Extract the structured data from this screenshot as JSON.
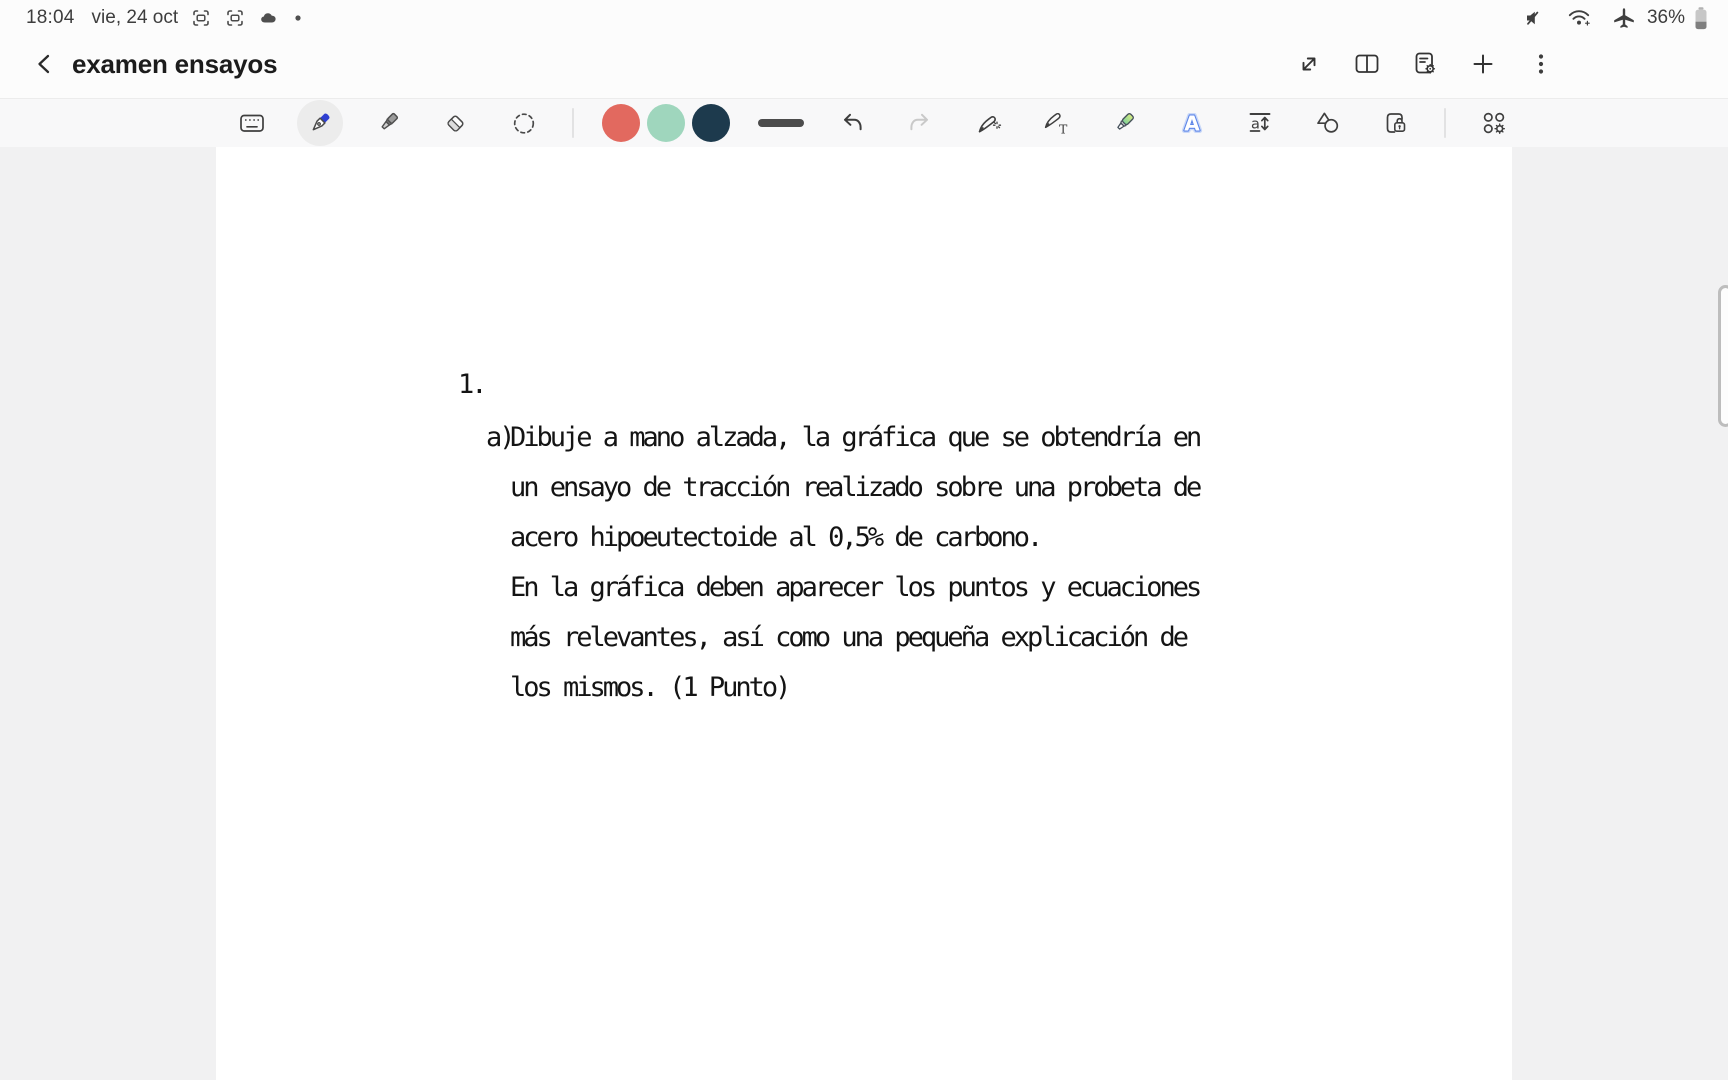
{
  "status_bar": {
    "time": "18:04",
    "date": "vie, 24 oct",
    "battery_percent": "36%"
  },
  "header": {
    "title": "examen ensayos"
  },
  "toolbar": {
    "selected_tool": "pen",
    "pen_ink_color": "#2E3FD1",
    "pen_colors": {
      "red": "#E2695F",
      "mint": "#9FD6BD",
      "navy": "#1D3A4D"
    },
    "icon_glyphs": {
      "handwriting_to_text": "T",
      "auto_format": "A",
      "text_size": "a"
    }
  },
  "document": {
    "question_number": "1.",
    "item_label": "a)",
    "lines": [
      "Dibuje a mano alzada, la gráfica que se obtendría en",
      "un ensayo de tracción realizado sobre una probeta de",
      "acero hipoeutectoide al 0,5% de carbono.",
      "En la gráfica deben aparecer los puntos y ecuaciones",
      "más relevantes, así como una pequeña explicación de",
      "los mismos. (1 Punto)"
    ]
  }
}
